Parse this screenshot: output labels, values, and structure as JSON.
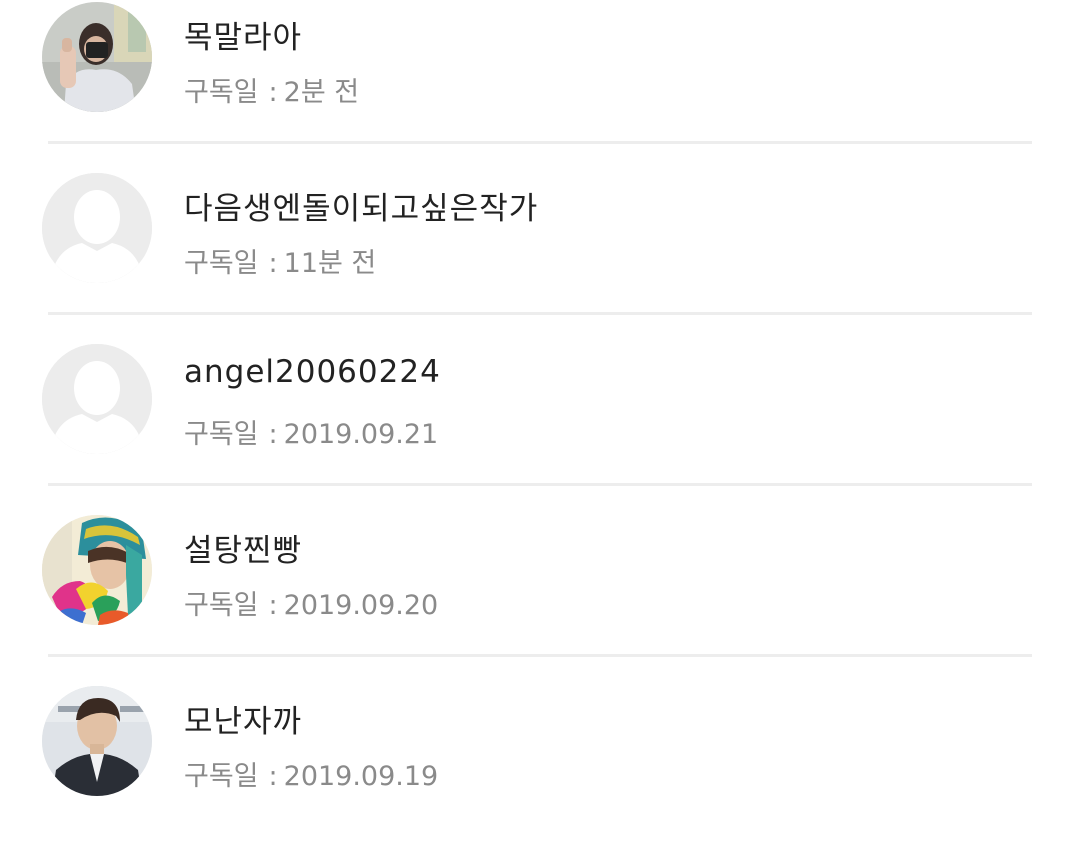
{
  "subscribers": [
    {
      "name": "목말라아",
      "date_label": "구독일",
      "date_value": "2분 전",
      "avatar": "photo-person-mirror-selfie"
    },
    {
      "name": "다음생엔돌이되고싶은작가",
      "date_label": "구독일",
      "date_value": "11분 전",
      "avatar": "default-profile-icon"
    },
    {
      "name": "angel20060224",
      "date_label": "구독일",
      "date_value": "2019.09.21",
      "avatar": "default-profile-icon"
    },
    {
      "name": "설탕찐빵",
      "date_label": "구독일",
      "date_value": "2019.09.20",
      "avatar": "photo-person-colorful-hat"
    },
    {
      "name": "모난자까",
      "date_label": "구독일",
      "date_value": "2019.09.19",
      "avatar": "photo-person-suit"
    }
  ],
  "separator": ":"
}
